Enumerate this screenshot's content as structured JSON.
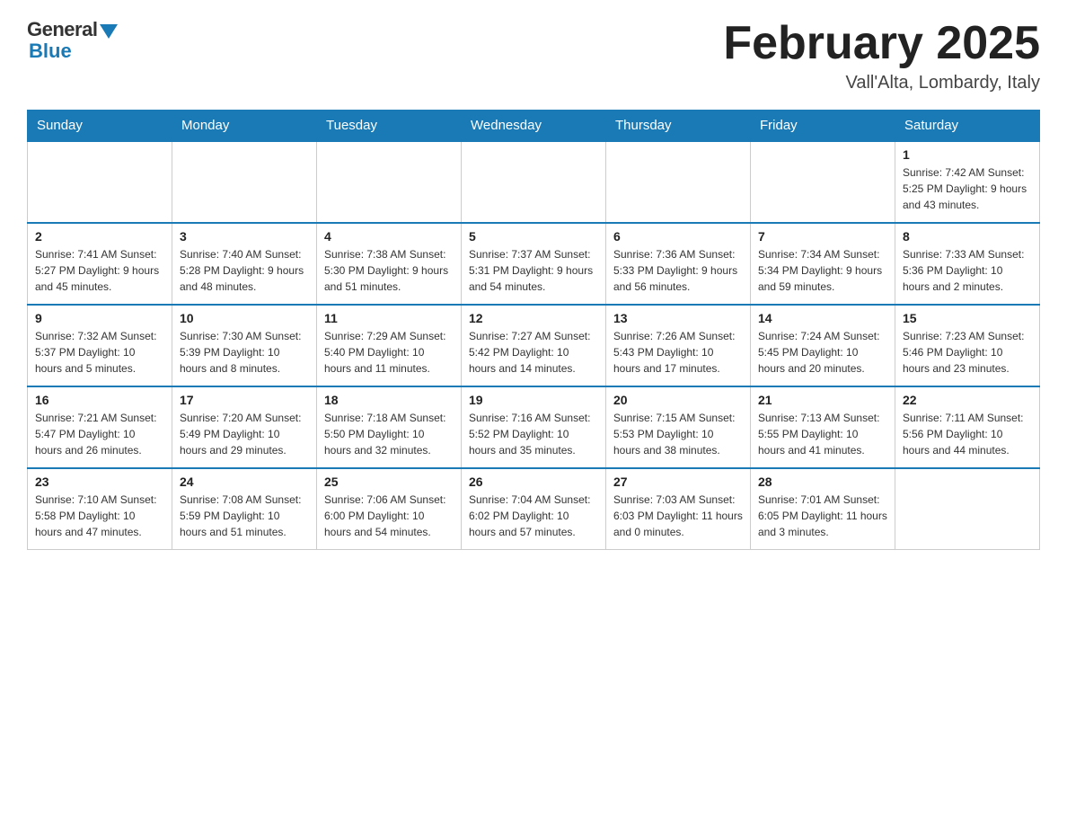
{
  "header": {
    "logo_general": "General",
    "logo_blue": "Blue",
    "month_title": "February 2025",
    "location": "Vall'Alta, Lombardy, Italy"
  },
  "days_of_week": [
    "Sunday",
    "Monday",
    "Tuesday",
    "Wednesday",
    "Thursday",
    "Friday",
    "Saturday"
  ],
  "weeks": [
    [
      {
        "day": "",
        "info": "",
        "empty": true
      },
      {
        "day": "",
        "info": "",
        "empty": true
      },
      {
        "day": "",
        "info": "",
        "empty": true
      },
      {
        "day": "",
        "info": "",
        "empty": true
      },
      {
        "day": "",
        "info": "",
        "empty": true
      },
      {
        "day": "",
        "info": "",
        "empty": true
      },
      {
        "day": "1",
        "info": "Sunrise: 7:42 AM\nSunset: 5:25 PM\nDaylight: 9 hours and 43 minutes.",
        "empty": false
      }
    ],
    [
      {
        "day": "2",
        "info": "Sunrise: 7:41 AM\nSunset: 5:27 PM\nDaylight: 9 hours and 45 minutes.",
        "empty": false
      },
      {
        "day": "3",
        "info": "Sunrise: 7:40 AM\nSunset: 5:28 PM\nDaylight: 9 hours and 48 minutes.",
        "empty": false
      },
      {
        "day": "4",
        "info": "Sunrise: 7:38 AM\nSunset: 5:30 PM\nDaylight: 9 hours and 51 minutes.",
        "empty": false
      },
      {
        "day": "5",
        "info": "Sunrise: 7:37 AM\nSunset: 5:31 PM\nDaylight: 9 hours and 54 minutes.",
        "empty": false
      },
      {
        "day": "6",
        "info": "Sunrise: 7:36 AM\nSunset: 5:33 PM\nDaylight: 9 hours and 56 minutes.",
        "empty": false
      },
      {
        "day": "7",
        "info": "Sunrise: 7:34 AM\nSunset: 5:34 PM\nDaylight: 9 hours and 59 minutes.",
        "empty": false
      },
      {
        "day": "8",
        "info": "Sunrise: 7:33 AM\nSunset: 5:36 PM\nDaylight: 10 hours and 2 minutes.",
        "empty": false
      }
    ],
    [
      {
        "day": "9",
        "info": "Sunrise: 7:32 AM\nSunset: 5:37 PM\nDaylight: 10 hours and 5 minutes.",
        "empty": false
      },
      {
        "day": "10",
        "info": "Sunrise: 7:30 AM\nSunset: 5:39 PM\nDaylight: 10 hours and 8 minutes.",
        "empty": false
      },
      {
        "day": "11",
        "info": "Sunrise: 7:29 AM\nSunset: 5:40 PM\nDaylight: 10 hours and 11 minutes.",
        "empty": false
      },
      {
        "day": "12",
        "info": "Sunrise: 7:27 AM\nSunset: 5:42 PM\nDaylight: 10 hours and 14 minutes.",
        "empty": false
      },
      {
        "day": "13",
        "info": "Sunrise: 7:26 AM\nSunset: 5:43 PM\nDaylight: 10 hours and 17 minutes.",
        "empty": false
      },
      {
        "day": "14",
        "info": "Sunrise: 7:24 AM\nSunset: 5:45 PM\nDaylight: 10 hours and 20 minutes.",
        "empty": false
      },
      {
        "day": "15",
        "info": "Sunrise: 7:23 AM\nSunset: 5:46 PM\nDaylight: 10 hours and 23 minutes.",
        "empty": false
      }
    ],
    [
      {
        "day": "16",
        "info": "Sunrise: 7:21 AM\nSunset: 5:47 PM\nDaylight: 10 hours and 26 minutes.",
        "empty": false
      },
      {
        "day": "17",
        "info": "Sunrise: 7:20 AM\nSunset: 5:49 PM\nDaylight: 10 hours and 29 minutes.",
        "empty": false
      },
      {
        "day": "18",
        "info": "Sunrise: 7:18 AM\nSunset: 5:50 PM\nDaylight: 10 hours and 32 minutes.",
        "empty": false
      },
      {
        "day": "19",
        "info": "Sunrise: 7:16 AM\nSunset: 5:52 PM\nDaylight: 10 hours and 35 minutes.",
        "empty": false
      },
      {
        "day": "20",
        "info": "Sunrise: 7:15 AM\nSunset: 5:53 PM\nDaylight: 10 hours and 38 minutes.",
        "empty": false
      },
      {
        "day": "21",
        "info": "Sunrise: 7:13 AM\nSunset: 5:55 PM\nDaylight: 10 hours and 41 minutes.",
        "empty": false
      },
      {
        "day": "22",
        "info": "Sunrise: 7:11 AM\nSunset: 5:56 PM\nDaylight: 10 hours and 44 minutes.",
        "empty": false
      }
    ],
    [
      {
        "day": "23",
        "info": "Sunrise: 7:10 AM\nSunset: 5:58 PM\nDaylight: 10 hours and 47 minutes.",
        "empty": false
      },
      {
        "day": "24",
        "info": "Sunrise: 7:08 AM\nSunset: 5:59 PM\nDaylight: 10 hours and 51 minutes.",
        "empty": false
      },
      {
        "day": "25",
        "info": "Sunrise: 7:06 AM\nSunset: 6:00 PM\nDaylight: 10 hours and 54 minutes.",
        "empty": false
      },
      {
        "day": "26",
        "info": "Sunrise: 7:04 AM\nSunset: 6:02 PM\nDaylight: 10 hours and 57 minutes.",
        "empty": false
      },
      {
        "day": "27",
        "info": "Sunrise: 7:03 AM\nSunset: 6:03 PM\nDaylight: 11 hours and 0 minutes.",
        "empty": false
      },
      {
        "day": "28",
        "info": "Sunrise: 7:01 AM\nSunset: 6:05 PM\nDaylight: 11 hours and 3 minutes.",
        "empty": false
      },
      {
        "day": "",
        "info": "",
        "empty": true
      }
    ]
  ]
}
